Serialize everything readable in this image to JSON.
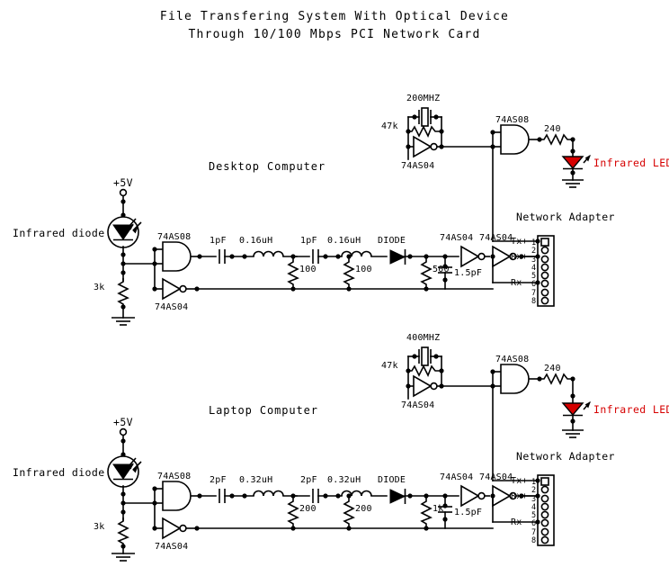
{
  "title": {
    "line1": "File Transfering System With Optical Device",
    "line2": "Through 10/100 Mbps PCI Network Card"
  },
  "circuits": [
    {
      "id": "desktop",
      "section_label": "Desktop Computer",
      "supply_label": "+5V",
      "sensor_label": "Infrared diode",
      "bias_resistor": "3k",
      "input_and_gate": "74AS08",
      "input_inverter": "74AS04",
      "filter": {
        "c1": "1pF",
        "l1": "0.16uH",
        "r1": "100",
        "c2": "1pF",
        "l2": "0.16uH",
        "r2": "100",
        "diode": "DIODE",
        "r3": "500",
        "c3": "1.5pF"
      },
      "out_inverter_1": "74AS04",
      "out_inverter_2": "74AS04",
      "oscillator": {
        "crystal": "200MHZ",
        "feedback_resistor": "47k",
        "inverter": "74AS04",
        "and_gate": "74AS08",
        "led_resistor": "240",
        "led_label": "Infrared LED"
      },
      "adapter": {
        "title": "Network Adapter",
        "tx_plus": "Tx+",
        "rx_plus": "Rx+",
        "rx_minus": "Rx-",
        "pins": [
          "1",
          "2",
          "3",
          "4",
          "5",
          "6",
          "7",
          "8"
        ]
      }
    },
    {
      "id": "laptop",
      "section_label": "Laptop Computer",
      "supply_label": "+5V",
      "sensor_label": "Infrared diode",
      "bias_resistor": "3k",
      "input_and_gate": "74AS08",
      "input_inverter": "74AS04",
      "filter": {
        "c1": "2pF",
        "l1": "0.32uH",
        "r1": "200",
        "c2": "2pF",
        "l2": "0.32uH",
        "r2": "200",
        "diode": "DIODE",
        "r3": "1k",
        "c3": "1.5pF"
      },
      "out_inverter_1": "74AS04",
      "out_inverter_2": "74AS04",
      "oscillator": {
        "crystal": "400MHZ",
        "feedback_resistor": "47k",
        "inverter": "74AS04",
        "and_gate": "74AS08",
        "led_resistor": "240",
        "led_label": "Infrared LED"
      },
      "adapter": {
        "title": "Network Adapter",
        "tx_plus": "Tx+",
        "rx_plus": "Rx+",
        "rx_minus": "Rx-",
        "pins": [
          "1",
          "2",
          "3",
          "4",
          "5",
          "6",
          "7",
          "8"
        ]
      }
    }
  ],
  "colors": {
    "wire": "#000000",
    "led": "#d60000",
    "background": "#ffffff"
  }
}
